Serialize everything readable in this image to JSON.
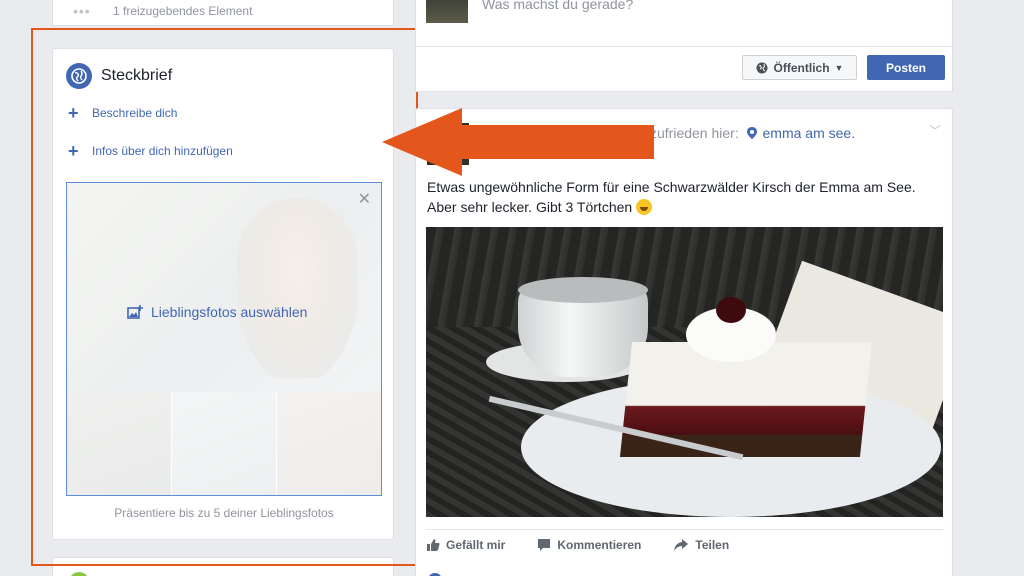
{
  "left_column": {
    "prev_card_text": "1 freizugebendes Element",
    "intro": {
      "title": "Steckbrief",
      "links": [
        "Beschreibe dich",
        "Infos über dich hinzufügen"
      ],
      "featured_photos_label": "Lieblingsfotos auswählen",
      "featured_photos_caption": "Präsentiere bis zu 5 deiner Lieblingsfotos"
    }
  },
  "composer": {
    "placeholder": "Was machst du gerade?",
    "privacy_label": "Öffentlich",
    "post_label": "Posten"
  },
  "post": {
    "feeling_text": "zufrieden hier:",
    "place": "emma am see.",
    "text": "Etwas ungewöhnliche Form für eine Schwarzwälder Kirsch der Emma am See. Aber sehr lecker. Gibt 3 Törtchen",
    "actions": [
      "Gefällt mir",
      "Kommentieren",
      "Teilen"
    ]
  },
  "colors": {
    "brand": "#4267b2",
    "highlight": "#e4571c",
    "page_bg": "#e9ebee"
  },
  "icons": [
    "globe-icon",
    "plus-icon",
    "photo-add-icon",
    "close-icon",
    "chevron-down-icon",
    "location-pin-icon",
    "like-icon",
    "comment-icon",
    "share-icon",
    "arrow-annotation"
  ]
}
